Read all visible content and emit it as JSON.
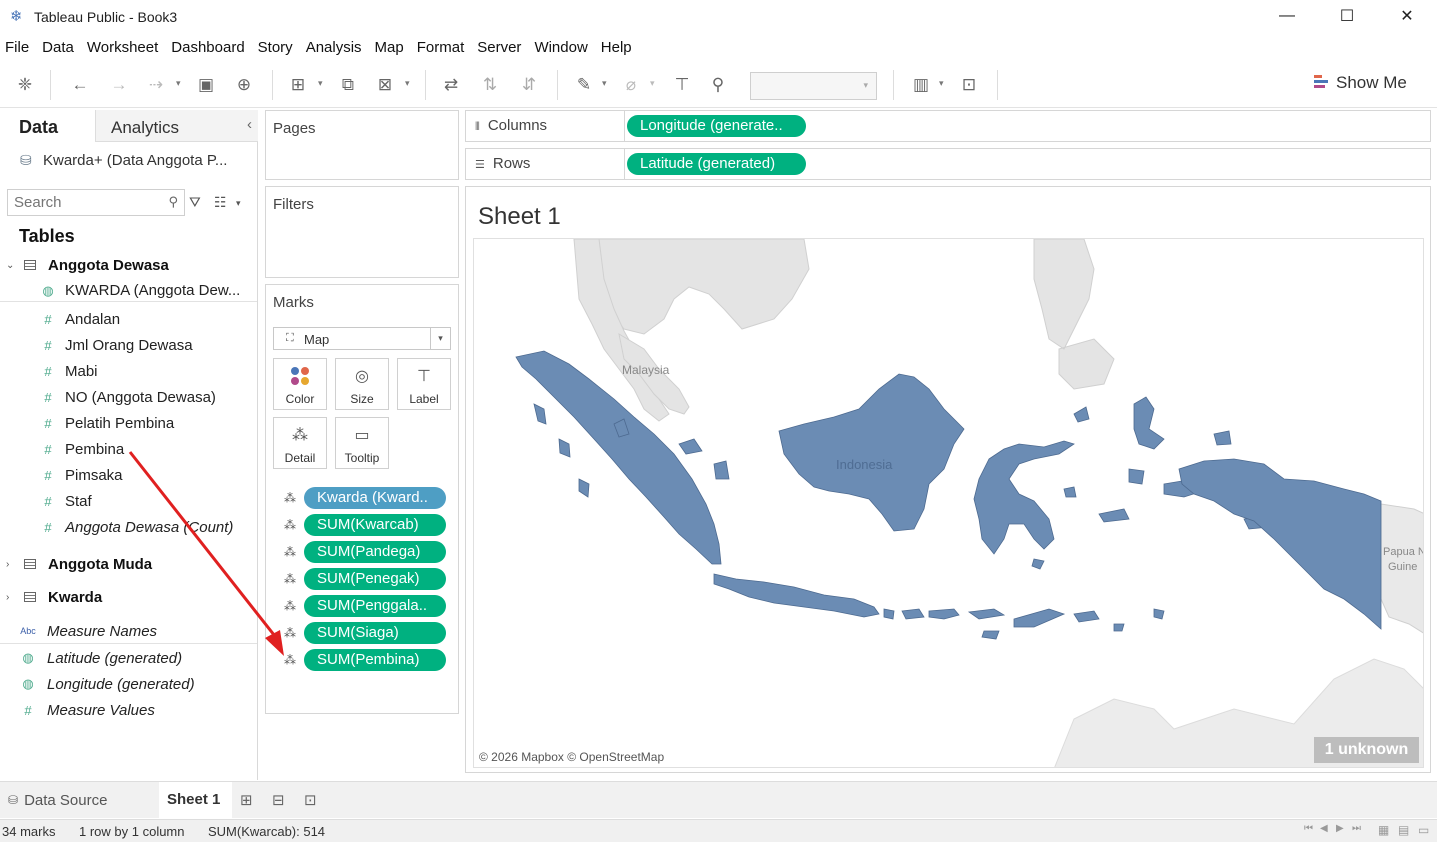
{
  "window": {
    "title": "Tableau Public - Book3",
    "minimize": "—",
    "maximize": "☐",
    "close": "✕"
  },
  "menu": [
    "File",
    "Data",
    "Worksheet",
    "Dashboard",
    "Story",
    "Analysis",
    "Map",
    "Format",
    "Server",
    "Window",
    "Help"
  ],
  "toolbar": {
    "show_me": "Show Me"
  },
  "data_pane": {
    "tab_data": "Data",
    "tab_analytics": "Analytics",
    "datasource": "Kwarda+ (Data Anggota P...",
    "search_placeholder": "Search",
    "tables_header": "Tables",
    "tables": [
      {
        "name": "Anggota Dewasa",
        "expanded": true,
        "fields": [
          {
            "label": "KWARDA (Anggota Dew...",
            "icon": "globe-icon",
            "italic": false
          },
          {
            "label": "Andalan",
            "icon": "measure-icon",
            "italic": false
          },
          {
            "label": "Jml Orang Dewasa",
            "icon": "measure-icon",
            "italic": false
          },
          {
            "label": "Mabi",
            "icon": "measure-icon",
            "italic": false
          },
          {
            "label": "NO (Anggota Dewasa)",
            "icon": "measure-icon",
            "italic": false
          },
          {
            "label": "Pelatih Pembina",
            "icon": "measure-icon",
            "italic": false
          },
          {
            "label": "Pembina",
            "icon": "measure-icon",
            "italic": false
          },
          {
            "label": "Pimsaka",
            "icon": "measure-icon",
            "italic": false
          },
          {
            "label": "Staf",
            "icon": "measure-icon",
            "italic": false
          },
          {
            "label": "Anggota Dewasa (Count)",
            "icon": "measure-icon",
            "italic": true
          }
        ]
      },
      {
        "name": "Anggota Muda",
        "expanded": false
      },
      {
        "name": "Kwarda",
        "expanded": false
      }
    ],
    "extra_fields": [
      {
        "label": "Measure Names",
        "icon": "abc-icon"
      },
      {
        "label": "Latitude (generated)",
        "icon": "globe-icon"
      },
      {
        "label": "Longitude (generated)",
        "icon": "globe-icon"
      },
      {
        "label": "Measure Values",
        "icon": "measure-icon"
      }
    ]
  },
  "cards": {
    "pages": "Pages",
    "filters": "Filters",
    "marks": "Marks",
    "mark_type": "Map",
    "mark_buttons": [
      "Color",
      "Size",
      "Label",
      "Detail",
      "Tooltip"
    ],
    "mark_pills": [
      {
        "label": "Kwarda (Kward..",
        "color": "#4e9ec4"
      },
      {
        "label": "SUM(Kwarcab)",
        "color": "#00b180"
      },
      {
        "label": "SUM(Pandega)",
        "color": "#00b180"
      },
      {
        "label": "SUM(Penegak)",
        "color": "#00b180"
      },
      {
        "label": "SUM(Penggala..",
        "color": "#00b180"
      },
      {
        "label": "SUM(Siaga)",
        "color": "#00b180"
      },
      {
        "label": "SUM(Pembina)",
        "color": "#00b180"
      }
    ]
  },
  "shelves": {
    "columns_label": "Columns",
    "columns_pill": "Longitude (generate..",
    "rows_label": "Rows",
    "rows_pill": "Latitude (generated)",
    "pill_color": "#00b180"
  },
  "sheet": {
    "title": "Sheet 1",
    "map_labels": {
      "malaysia": "Malaysia",
      "indonesia": "Indonesia",
      "papua": "Papua N",
      "guinea": "Guine"
    },
    "attribution": "© 2026 Mapbox © OpenStreetMap",
    "unknown_badge": "1 unknown",
    "region_color": "#6b8cb4"
  },
  "bottom_tabs": {
    "data_source": "Data Source",
    "sheet1": "Sheet 1"
  },
  "status": {
    "marks": "34 marks",
    "dims": "1 row by 1 column",
    "sum": "SUM(Kwarcab): 514"
  },
  "annotation": {
    "color": "#e02020"
  }
}
